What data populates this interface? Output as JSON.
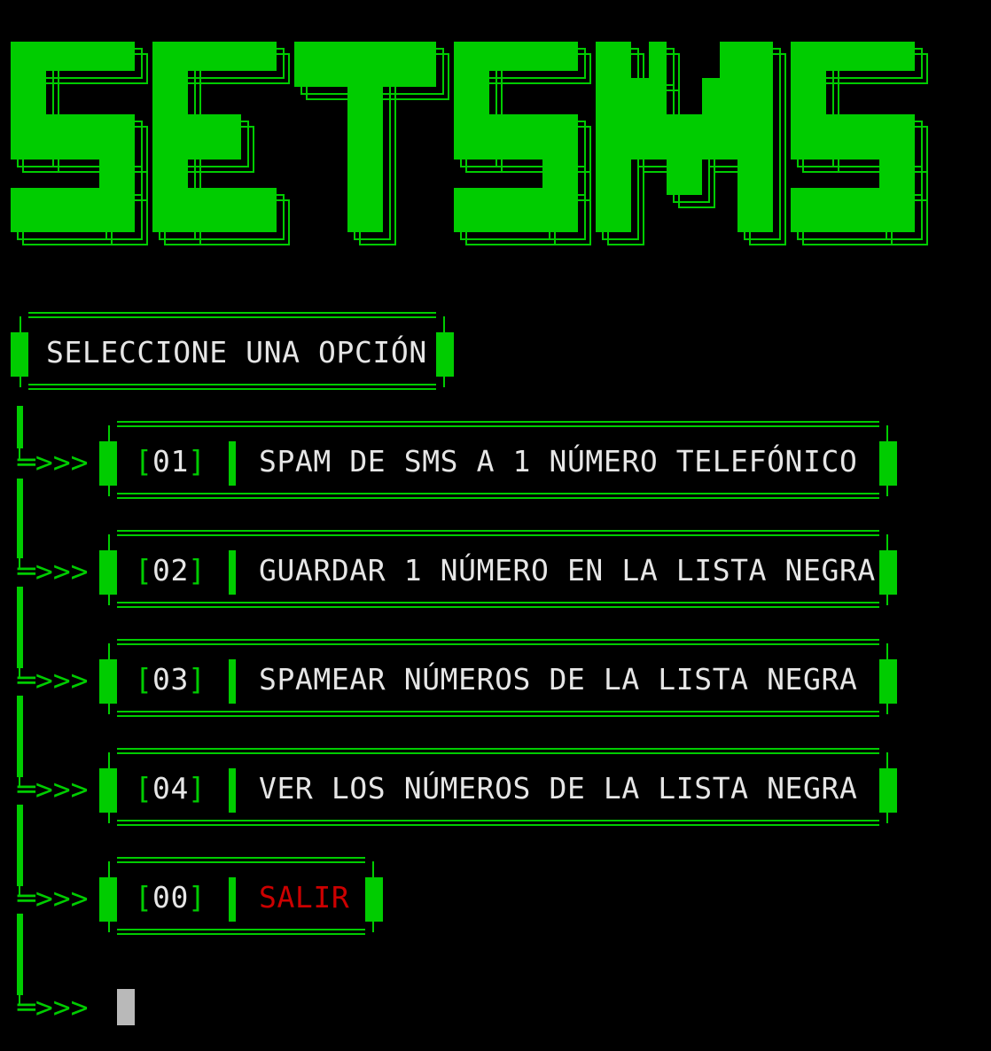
{
  "banner": {
    "title": "SETSMS"
  },
  "menu": {
    "heading": "SELECCIONE UNA OPCIÓN",
    "arrow": "═>>>",
    "options": [
      {
        "num": "01",
        "label": "SPAM DE SMS A 1 NÚMERO TELEFÓNICO"
      },
      {
        "num": "02",
        "label": "GUARDAR 1 NÚMERO EN LA LISTA NEGRA"
      },
      {
        "num": "03",
        "label": "SPAMEAR NÚMEROS DE LA LISTA NEGRA"
      },
      {
        "num": "04",
        "label": "VER LOS NÚMEROS DE LA LISTA NEGRA"
      },
      {
        "num": "00",
        "label": "SALIR"
      }
    ],
    "bracket_open": "[",
    "bracket_close": "]"
  },
  "prompt": {
    "arrow": "═>>>"
  },
  "colors": {
    "background": "#000000",
    "accent_green": "#00cc00",
    "text": "#e6e6e6",
    "exit_red": "#cc0000",
    "cursor": "#b9b9b9"
  }
}
